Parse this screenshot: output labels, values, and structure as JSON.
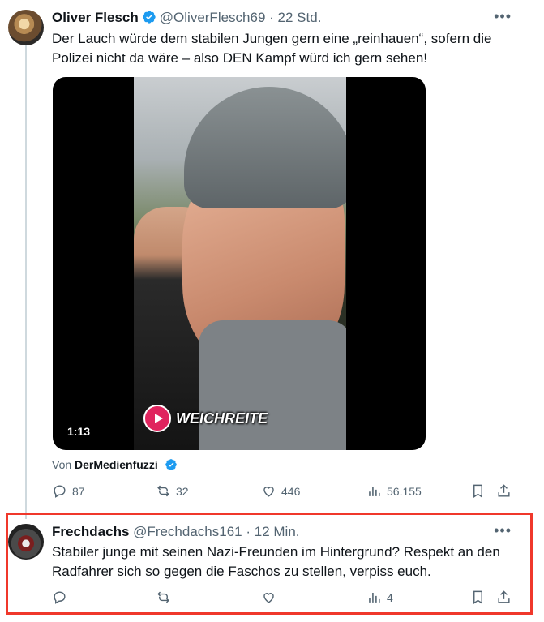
{
  "tweet1": {
    "name": "Oliver Flesch",
    "handle": "@OliverFlesch69",
    "time": "· 22 Std.",
    "text": "Der Lauch würde dem stabilen Jungen gern eine „reinhauen“, sofern die Polizei nicht da wäre – also DEN Kampf würd ich gern sehen!",
    "media": {
      "duration": "1:13",
      "watermark": "WEICHREITE"
    },
    "source_prefix": "Von",
    "source_account": "DerMedienfuzzi",
    "replies": "87",
    "reposts": "32",
    "likes": "446",
    "views": "56.155"
  },
  "tweet2": {
    "name": "Frechdachs",
    "handle": "@Frechdachs161",
    "time": "· 12 Min.",
    "text": "Stabiler junge mit seinen Nazi-Freunden im Hintergrund? Respekt an den Radfahrer sich so gegen die Faschos zu stellen, verpiss euch.",
    "views": "4"
  },
  "icons": [
    "verified-badge-icon",
    "more-icon",
    "reply-icon",
    "repost-icon",
    "like-icon",
    "views-icon",
    "bookmark-icon",
    "share-icon",
    "play-icon"
  ],
  "colors": {
    "verified": "#1d9bf0",
    "highlight": "#f0382b",
    "muted": "#536471"
  }
}
